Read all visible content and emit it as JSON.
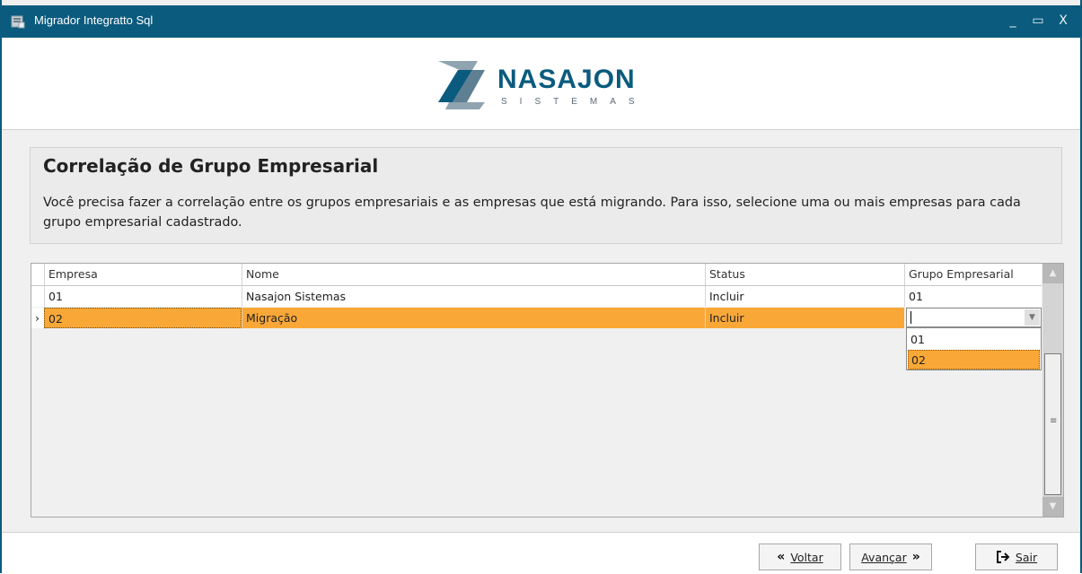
{
  "window": {
    "title": "Migrador Integratto Sql",
    "controls": {
      "minimize": "_",
      "maximize": "▭",
      "close": "X"
    }
  },
  "logo": {
    "brand": "NASAJON",
    "sub": "SISTEMAS"
  },
  "info": {
    "title": "Correlação de Grupo Empresarial",
    "text": "Você precisa fazer a correlação entre os grupos empresariais e as empresas que está migrando. Para isso, selecione uma ou mais empresas para cada grupo empresarial cadastrado."
  },
  "grid": {
    "columns": [
      "Empresa",
      "Nome",
      "Status",
      "Grupo Empresarial"
    ],
    "rows": [
      {
        "empresa": "01",
        "nome": "Nasajon Sistemas",
        "status": "Incluir",
        "grupo": "01",
        "selected": false
      },
      {
        "empresa": "02",
        "nome": "Migração",
        "status": "Incluir",
        "grupo": "",
        "selected": true
      }
    ],
    "row_indicator": "›",
    "dropdown_options": [
      "01",
      "02"
    ],
    "dropdown_selected": "02"
  },
  "buttons": {
    "voltar": {
      "label": "Voltar",
      "icon": "double-chevron-left-icon"
    },
    "avancar": {
      "label": "Avançar",
      "icon": "double-chevron-right-icon"
    },
    "sair": {
      "label": "Sair",
      "icon": "exit-icon"
    }
  },
  "colors": {
    "titlebar": "#0b5b7e",
    "selection": "#f9a838"
  }
}
